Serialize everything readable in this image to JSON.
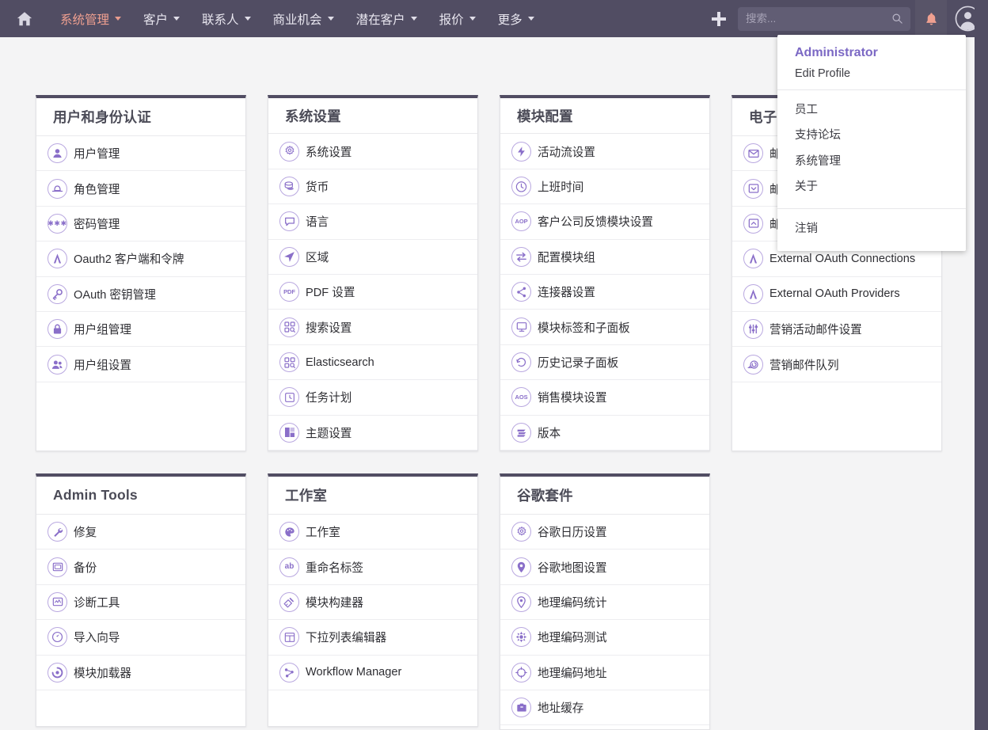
{
  "navbar": {
    "home_icon": "home-icon",
    "menu": [
      {
        "label": "系统管理",
        "active": true
      },
      {
        "label": "客户",
        "active": false
      },
      {
        "label": "联系人",
        "active": false
      },
      {
        "label": "商业机会",
        "active": false
      },
      {
        "label": "潜在客户",
        "active": false
      },
      {
        "label": "报价",
        "active": false
      },
      {
        "label": "更多",
        "active": false
      }
    ],
    "add_icon": "plus-icon",
    "search": {
      "placeholder": "搜索...",
      "value": "",
      "icon": "search-icon"
    },
    "bell_icon": "bell-icon",
    "avatar_icon": "user-avatar-icon"
  },
  "user_menu": {
    "name": "Administrator",
    "edit_profile": "Edit Profile",
    "group": [
      "员工",
      "支持论坛",
      "系统管理",
      "关于"
    ],
    "logout": "注销"
  },
  "colors": {
    "navbar_bg": "#514d63",
    "accent_purple": "#7b68c4",
    "active_nav": "#f0a090",
    "icon_purple": "#8a6fc9",
    "page_bg": "#f4f4f5",
    "card_bg": "#ffffff",
    "bell": "#f0a090"
  },
  "cards": [
    {
      "title": "用户和身份认证",
      "items": [
        {
          "label": "用户管理",
          "icon": "user-icon"
        },
        {
          "label": "角色管理",
          "icon": "hat-icon"
        },
        {
          "label": "密码管理",
          "icon": "asterisks-icon"
        },
        {
          "label": "Oauth2 客户端和令牌",
          "icon": "oauth-a-icon"
        },
        {
          "label": "OAuth 密钥管理",
          "icon": "key-icon"
        },
        {
          "label": "用户组管理",
          "icon": "lock-icon"
        },
        {
          "label": "用户组设置",
          "icon": "users-icon"
        }
      ]
    },
    {
      "title": "系统设置",
      "items": [
        {
          "label": "系统设置",
          "icon": "gear-icon"
        },
        {
          "label": "货币",
          "icon": "coins-icon"
        },
        {
          "label": "语言",
          "icon": "speech-bubble-icon"
        },
        {
          "label": "区域",
          "icon": "navigation-arrow-icon"
        },
        {
          "label": "PDF 设置",
          "icon": "pdf-icon"
        },
        {
          "label": "搜索设置",
          "icon": "search-blocks-icon"
        },
        {
          "label": "Elasticsearch",
          "icon": "search-blocks-icon"
        },
        {
          "label": "任务计划",
          "icon": "clock-icon"
        },
        {
          "label": "主题设置",
          "icon": "theme-squares-icon"
        }
      ]
    },
    {
      "title": "模块配置",
      "items": [
        {
          "label": "活动流设置",
          "icon": "bolt-icon"
        },
        {
          "label": "上班时间",
          "icon": "clock-circle-icon"
        },
        {
          "label": "客户公司反馈模块设置",
          "icon": "aop-icon"
        },
        {
          "label": "配置模块组",
          "icon": "arrows-lr-icon"
        },
        {
          "label": "连接器设置",
          "icon": "share-nodes-icon"
        },
        {
          "label": "模块标签和子面板",
          "icon": "monitor-icon"
        },
        {
          "label": "历史记录子面板",
          "icon": "history-icon"
        },
        {
          "label": "销售模块设置",
          "icon": "aos-icon"
        },
        {
          "label": "版本",
          "icon": "layers-icon"
        }
      ]
    },
    {
      "title": "电子邮件",
      "items": [
        {
          "label": "邮件设置",
          "icon": "envelope-icon"
        },
        {
          "label": "邮件收件箱",
          "icon": "inbox-icon"
        },
        {
          "label": "邮件发件箱",
          "icon": "outbox-icon"
        },
        {
          "label": "External OAuth Connections",
          "icon": "oauth-a-icon"
        },
        {
          "label": "External OAuth Providers",
          "icon": "oauth-a-icon"
        },
        {
          "label": "营销活动邮件设置",
          "icon": "sliders-icon"
        },
        {
          "label": "营销邮件队列",
          "icon": "snail-icon"
        }
      ]
    },
    {
      "title": "Admin Tools",
      "items": [
        {
          "label": "修复",
          "icon": "wrench-icon"
        },
        {
          "label": "备份",
          "icon": "archive-icon"
        },
        {
          "label": "诊断工具",
          "icon": "diagnostic-icon"
        },
        {
          "label": "导入向导",
          "icon": "import-icon"
        },
        {
          "label": "模块加载器",
          "icon": "loader-icon"
        }
      ]
    },
    {
      "title": "工作室",
      "items": [
        {
          "label": "工作室",
          "icon": "palette-icon"
        },
        {
          "label": "重命名标签",
          "icon": "ab-icon"
        },
        {
          "label": "模块构建器",
          "icon": "module-builder-icon"
        },
        {
          "label": "下拉列表编辑器",
          "icon": "table-icon"
        },
        {
          "label": "Workflow Manager",
          "icon": "workflow-icon"
        }
      ]
    },
    {
      "title": "谷歌套件",
      "items": [
        {
          "label": "谷歌日历设置",
          "icon": "gear-icon"
        },
        {
          "label": "谷歌地图设置",
          "icon": "map-pin-icon"
        },
        {
          "label": "地理编码统计",
          "icon": "map-pin-outline-icon"
        },
        {
          "label": "地理编码测试",
          "icon": "crosshair-burst-icon"
        },
        {
          "label": "地理编码地址",
          "icon": "circle-dots-icon"
        },
        {
          "label": "地址缓存",
          "icon": "archive-box-icon"
        }
      ]
    }
  ]
}
